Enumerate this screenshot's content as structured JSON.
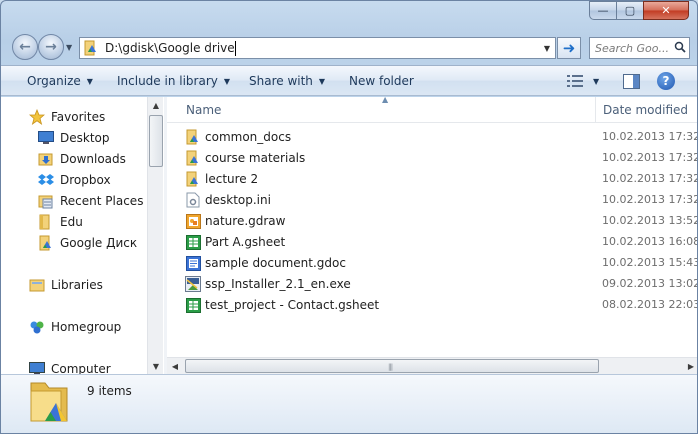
{
  "window": {
    "minimize_label": "—",
    "maximize_label": "▢",
    "close_label": "✕"
  },
  "nav": {
    "back_glyph": "←",
    "forward_glyph": "→",
    "address": "D:\\gdisk\\Google drive",
    "go_glyph": "➜",
    "search_placeholder": "Search Goo..."
  },
  "toolbar": {
    "organize": "Organize",
    "include_in_library": "Include in library",
    "share_with": "Share with",
    "new_folder": "New folder",
    "help": "?"
  },
  "sidebar": {
    "favorites": "Favorites",
    "items": [
      {
        "label": "Desktop",
        "icon": "desktop-icon"
      },
      {
        "label": "Downloads",
        "icon": "downloads-folder-icon"
      },
      {
        "label": "Dropbox",
        "icon": "dropbox-icon"
      },
      {
        "label": "Recent Places",
        "icon": "recent-places-icon"
      },
      {
        "label": "Edu",
        "icon": "folder-icon"
      },
      {
        "label": "Google Диск",
        "icon": "google-drive-folder-icon"
      }
    ],
    "libraries": "Libraries",
    "homegroup": "Homegroup",
    "computer": "Computer"
  },
  "columns": {
    "name": "Name",
    "date_modified": "Date modified"
  },
  "files": [
    {
      "name": "common_docs",
      "date": "10.02.2013 17:32",
      "icon": "drive-folder-icon"
    },
    {
      "name": "course materials",
      "date": "10.02.2013 17:32",
      "icon": "drive-folder-icon"
    },
    {
      "name": "lecture 2",
      "date": "10.02.2013 17:32",
      "icon": "drive-folder-icon"
    },
    {
      "name": "desktop.ini",
      "date": "10.02.2013 17:32",
      "icon": "settings-file-icon"
    },
    {
      "name": "nature.gdraw",
      "date": "10.02.2013 13:52",
      "icon": "gdraw-file-icon"
    },
    {
      "name": "Part A.gsheet",
      "date": "10.02.2013 16:08",
      "icon": "gsheet-file-icon"
    },
    {
      "name": "sample document.gdoc",
      "date": "10.02.2013 15:43",
      "icon": "gdoc-file-icon"
    },
    {
      "name": "ssp_Installer_2.1_en.exe",
      "date": "09.02.2013 13:02",
      "icon": "exe-file-icon"
    },
    {
      "name": "test_project - Contact.gsheet",
      "date": "08.02.2013 22:03",
      "icon": "gsheet-file-icon"
    }
  ],
  "details": {
    "item_count": "9 items"
  },
  "colors": {
    "window_frame": "#c7dbef",
    "toolbar_text": "#1e395b",
    "folder_yellow": "#f7dd8a",
    "drive_green": "#2a9d47",
    "drive_blue": "#3b73d6"
  }
}
